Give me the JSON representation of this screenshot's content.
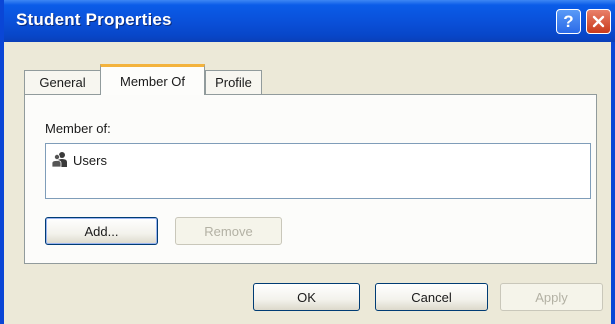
{
  "window": {
    "title": "Student Properties",
    "help_glyph": "?",
    "close_icon": "close-icon",
    "title_color": "#0a4fd8"
  },
  "tabs": [
    {
      "label": "General",
      "selected": false
    },
    {
      "label": "Member Of",
      "selected": true
    },
    {
      "label": "Profile",
      "selected": false
    }
  ],
  "member_of": {
    "label": "Member of:",
    "items": [
      {
        "label": "Users",
        "icon": "user-group-icon"
      }
    ]
  },
  "buttons": {
    "add": "Add...",
    "remove": "Remove",
    "ok": "OK",
    "cancel": "Cancel",
    "apply": "Apply"
  }
}
